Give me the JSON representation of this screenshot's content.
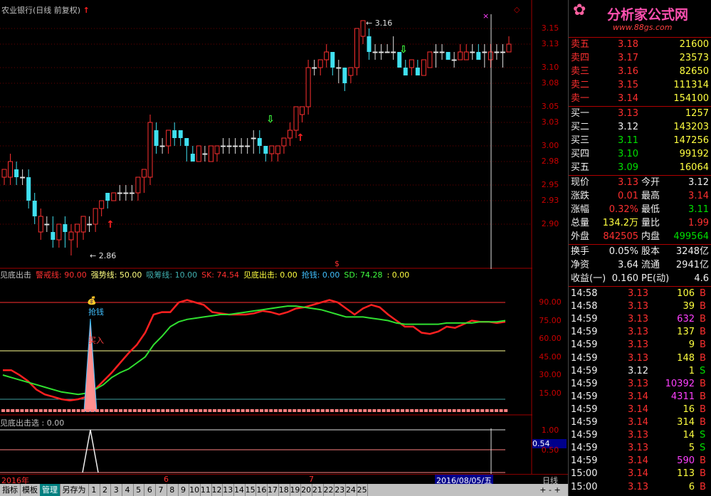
{
  "header": {
    "title": "农业银行(日线 前复权)",
    "up_marker": "↑",
    "x_marker": "×",
    "diamond_marker": "◇"
  },
  "main_axis": [
    "3.15",
    "3.13",
    "3.10",
    "3.08",
    "3.05",
    "3.03",
    "3.00",
    "2.98",
    "2.95",
    "2.93",
    "2.90"
  ],
  "annotations": {
    "high": "3.16",
    "low": "2.86",
    "dollar": "$"
  },
  "indicator": {
    "legend": [
      {
        "text": "见底出击",
        "color": "#c0c0c0"
      },
      {
        "text": "警戒线: 90.00",
        "color": "#ff3030"
      },
      {
        "text": "强势线: 50.00",
        "color": "#ffff80"
      },
      {
        "text": "吸筹线: 10.00",
        "color": "#40b0b0"
      },
      {
        "text": "SK: 74.54",
        "color": "#ff3030"
      },
      {
        "text": "见底出击: 0.00",
        "color": "#ffff40"
      },
      {
        "text": "抢钱: 0.00",
        "color": "#40c0ff"
      },
      {
        "text": "SD: 74.28",
        "color": "#40ff40"
      },
      {
        "text": ": 0.00",
        "color": "#ffff40"
      }
    ],
    "axis": [
      "90.00",
      "75.00",
      "60.00",
      "45.00",
      "30.00",
      "15.00"
    ],
    "label_qiangqian": "抢钱",
    "label_mairu": "买入"
  },
  "sub": {
    "legend": "见底出击选 : 0.00",
    "axis": [
      "1.00",
      "0.50"
    ],
    "cursor_value": "0.54"
  },
  "dates": {
    "year": "2016年",
    "m6": "6",
    "m7": "7",
    "cursor_date": "2016/08/05/五",
    "period": "日线"
  },
  "bottom_tabs": [
    "指标",
    "模板",
    "管理",
    "另存为",
    "1",
    "2",
    "3",
    "4",
    "5",
    "6",
    "7",
    "8",
    "9",
    "10",
    "11",
    "12",
    "13",
    "14",
    "15",
    "16",
    "17",
    "18",
    "19",
    "20",
    "21",
    "22",
    "23",
    "24",
    "25"
  ],
  "brand": {
    "name": "分析家公式网",
    "url": "www.88gs.com"
  },
  "orderbook": {
    "asks": [
      {
        "label": "卖五",
        "price": "3.18",
        "vol": "21600"
      },
      {
        "label": "卖四",
        "price": "3.17",
        "vol": "23573"
      },
      {
        "label": "卖三",
        "price": "3.16",
        "vol": "82650"
      },
      {
        "label": "卖二",
        "price": "3.15",
        "vol": "111314"
      },
      {
        "label": "卖一",
        "price": "3.14",
        "vol": "154100"
      }
    ],
    "bids": [
      {
        "label": "买一",
        "price": "3.13",
        "vol": "1257",
        "pc": "red"
      },
      {
        "label": "买二",
        "price": "3.12",
        "vol": "143203",
        "pc": "wht"
      },
      {
        "label": "买三",
        "price": "3.11",
        "vol": "147256",
        "pc": "grn"
      },
      {
        "label": "买四",
        "price": "3.10",
        "vol": "99192",
        "pc": "grn"
      },
      {
        "label": "买五",
        "price": "3.09",
        "vol": "16064",
        "pc": "grn"
      }
    ]
  },
  "quote": [
    {
      "l": "现价",
      "v": "3.13",
      "vc": "red",
      "l2": "今开",
      "v2": "3.12",
      "v2c": "wht"
    },
    {
      "l": "涨跌",
      "v": "0.01",
      "vc": "red",
      "l2": "最高",
      "v2": "3.14",
      "v2c": "red"
    },
    {
      "l": "涨幅",
      "v": "0.32%",
      "vc": "red",
      "l2": "最低",
      "v2": "3.11",
      "v2c": "grn"
    },
    {
      "l": "总量",
      "v": "134.2万",
      "vc": "yel",
      "l2": "量比",
      "v2": "1.99",
      "v2c": "red"
    },
    {
      "l": "外盘",
      "v": "842505",
      "vc": "red",
      "l2": "内盘",
      "v2": "499564",
      "v2c": "grn"
    }
  ],
  "stats": [
    {
      "l": "换手",
      "v": "0.05%",
      "l2": "股本",
      "v2": "3248亿"
    },
    {
      "l": "净资",
      "v": "3.64",
      "l2": "流通",
      "v2": "2941亿"
    },
    {
      "l": "收益(一)",
      "v": "0.160",
      "l2": "PE(动)",
      "v2": "4.6"
    }
  ],
  "ticks": [
    {
      "t": "14:58",
      "p": "3.13",
      "pc": "red",
      "v": "106",
      "vc": "yel",
      "s": "B",
      "sc": "red"
    },
    {
      "t": "14:58",
      "p": "3.13",
      "pc": "red",
      "v": "39",
      "vc": "yel",
      "s": "B",
      "sc": "red"
    },
    {
      "t": "14:59",
      "p": "3.13",
      "pc": "red",
      "v": "632",
      "vc": "mag",
      "s": "B",
      "sc": "red"
    },
    {
      "t": "14:59",
      "p": "3.13",
      "pc": "red",
      "v": "137",
      "vc": "yel",
      "s": "B",
      "sc": "red"
    },
    {
      "t": "14:59",
      "p": "3.13",
      "pc": "red",
      "v": "9",
      "vc": "yel",
      "s": "B",
      "sc": "red"
    },
    {
      "t": "14:59",
      "p": "3.13",
      "pc": "red",
      "v": "148",
      "vc": "yel",
      "s": "B",
      "sc": "red"
    },
    {
      "t": "14:59",
      "p": "3.12",
      "pc": "wht",
      "v": "1",
      "vc": "yel",
      "s": "S",
      "sc": "grn"
    },
    {
      "t": "14:59",
      "p": "3.13",
      "pc": "red",
      "v": "10392",
      "vc": "mag",
      "s": "B",
      "sc": "red"
    },
    {
      "t": "14:59",
      "p": "3.14",
      "pc": "red",
      "v": "4311",
      "vc": "mag",
      "s": "B",
      "sc": "red"
    },
    {
      "t": "14:59",
      "p": "3.14",
      "pc": "red",
      "v": "16",
      "vc": "yel",
      "s": "B",
      "sc": "red"
    },
    {
      "t": "14:59",
      "p": "3.14",
      "pc": "red",
      "v": "314",
      "vc": "yel",
      "s": "B",
      "sc": "red"
    },
    {
      "t": "14:59",
      "p": "3.13",
      "pc": "red",
      "v": "14",
      "vc": "yel",
      "s": "S",
      "sc": "grn"
    },
    {
      "t": "14:59",
      "p": "3.13",
      "pc": "red",
      "v": "5",
      "vc": "yel",
      "s": "S",
      "sc": "grn"
    },
    {
      "t": "14:59",
      "p": "3.14",
      "pc": "red",
      "v": "590",
      "vc": "mag",
      "s": "B",
      "sc": "red"
    },
    {
      "t": "15:00",
      "p": "3.14",
      "pc": "red",
      "v": "113",
      "vc": "yel",
      "s": "B",
      "sc": "red"
    },
    {
      "t": "15:00",
      "p": "3.13",
      "pc": "red",
      "v": "6",
      "vc": "yel",
      "s": "B",
      "sc": "red"
    }
  ],
  "chart_data": {
    "type": "candlestick",
    "candles": [
      {
        "o": 2.96,
        "c": 2.97,
        "h": 2.97,
        "l": 2.95
      },
      {
        "o": 2.96,
        "c": 2.98,
        "h": 2.99,
        "l": 2.95
      },
      {
        "o": 2.97,
        "c": 2.96,
        "h": 2.98,
        "l": 2.95
      },
      {
        "o": 2.96,
        "c": 2.96,
        "h": 2.97,
        "l": 2.95
      },
      {
        "o": 2.96,
        "c": 2.93,
        "h": 2.97,
        "l": 2.92
      },
      {
        "o": 2.93,
        "c": 2.91,
        "h": 2.94,
        "l": 2.9
      },
      {
        "o": 2.89,
        "c": 2.91,
        "h": 2.92,
        "l": 2.88
      },
      {
        "o": 2.9,
        "c": 2.9,
        "h": 2.91,
        "l": 2.89
      },
      {
        "o": 2.89,
        "c": 2.88,
        "h": 2.91,
        "l": 2.87
      },
      {
        "o": 2.88,
        "c": 2.9,
        "h": 2.9,
        "l": 2.87
      },
      {
        "o": 2.9,
        "c": 2.89,
        "h": 2.91,
        "l": 2.87
      },
      {
        "o": 2.88,
        "c": 2.89,
        "h": 2.9,
        "l": 2.86
      },
      {
        "o": 2.89,
        "c": 2.9,
        "h": 2.9,
        "l": 2.87
      },
      {
        "o": 2.89,
        "c": 2.91,
        "h": 2.91,
        "l": 2.88
      },
      {
        "o": 2.9,
        "c": 2.9,
        "h": 2.91,
        "l": 2.89
      },
      {
        "o": 2.9,
        "c": 2.92,
        "h": 2.92,
        "l": 2.89
      },
      {
        "o": 2.92,
        "c": 2.93,
        "h": 2.93,
        "l": 2.91
      },
      {
        "o": 2.94,
        "c": 2.93,
        "h": 2.94,
        "l": 2.92
      },
      {
        "o": 2.93,
        "c": 2.94,
        "h": 2.94,
        "l": 2.93
      },
      {
        "o": 2.94,
        "c": 2.94,
        "h": 2.95,
        "l": 2.93
      },
      {
        "o": 2.94,
        "c": 2.94,
        "h": 2.95,
        "l": 2.93
      },
      {
        "o": 2.94,
        "c": 2.94,
        "h": 2.95,
        "l": 2.93
      },
      {
        "o": 2.94,
        "c": 2.96,
        "h": 2.96,
        "l": 2.93
      },
      {
        "o": 2.96,
        "c": 2.97,
        "h": 2.97,
        "l": 2.94
      },
      {
        "o": 2.96,
        "c": 3.03,
        "h": 3.04,
        "l": 2.95
      },
      {
        "o": 3.02,
        "c": 3.0,
        "h": 3.03,
        "l": 2.99
      },
      {
        "o": 3.0,
        "c": 3.0,
        "h": 3.01,
        "l": 2.99
      },
      {
        "o": 3.0,
        "c": 3.02,
        "h": 3.02,
        "l": 2.99
      },
      {
        "o": 3.02,
        "c": 3.01,
        "h": 3.03,
        "l": 3.0
      },
      {
        "o": 3.02,
        "c": 3.01,
        "h": 3.02,
        "l": 3.0
      },
      {
        "o": 3.01,
        "c": 3.0,
        "h": 3.01,
        "l": 2.98
      },
      {
        "o": 2.99,
        "c": 2.98,
        "h": 3.0,
        "l": 2.98
      },
      {
        "o": 2.98,
        "c": 3.0,
        "h": 3.0,
        "l": 2.98
      },
      {
        "o": 2.99,
        "c": 2.99,
        "h": 3.0,
        "l": 2.98
      },
      {
        "o": 2.98,
        "c": 3.0,
        "h": 3.0,
        "l": 2.98
      },
      {
        "o": 2.99,
        "c": 3.0,
        "h": 3.0,
        "l": 2.98
      },
      {
        "o": 3.0,
        "c": 3.0,
        "h": 3.01,
        "l": 2.99
      },
      {
        "o": 3.0,
        "c": 3.0,
        "h": 3.01,
        "l": 2.99
      },
      {
        "o": 3.0,
        "c": 3.0,
        "h": 3.01,
        "l": 2.99
      },
      {
        "o": 3.0,
        "c": 3.0,
        "h": 3.01,
        "l": 2.99
      },
      {
        "o": 3.0,
        "c": 3.0,
        "h": 3.01,
        "l": 2.99
      },
      {
        "o": 3.01,
        "c": 3.01,
        "h": 3.02,
        "l": 2.99
      },
      {
        "o": 3.01,
        "c": 3.0,
        "h": 3.02,
        "l": 2.99
      },
      {
        "o": 3.0,
        "c": 2.99,
        "h": 3.0,
        "l": 2.98
      },
      {
        "o": 2.99,
        "c": 3.0,
        "h": 3.0,
        "l": 2.98
      },
      {
        "o": 2.99,
        "c": 3.0,
        "h": 3.0,
        "l": 2.98
      },
      {
        "o": 3.0,
        "c": 3.01,
        "h": 3.01,
        "l": 2.99
      },
      {
        "o": 3.01,
        "c": 3.02,
        "h": 3.03,
        "l": 3.0
      },
      {
        "o": 3.02,
        "c": 3.05,
        "h": 3.05,
        "l": 3.01
      },
      {
        "o": 3.04,
        "c": 3.05,
        "h": 3.05,
        "l": 3.03
      },
      {
        "o": 3.05,
        "c": 3.1,
        "h": 3.11,
        "l": 3.04
      },
      {
        "o": 3.1,
        "c": 3.1,
        "h": 3.11,
        "l": 3.09
      },
      {
        "o": 3.1,
        "c": 3.11,
        "h": 3.11,
        "l": 3.09
      },
      {
        "o": 3.11,
        "c": 3.12,
        "h": 3.13,
        "l": 3.1
      },
      {
        "o": 3.12,
        "c": 3.1,
        "h": 3.12,
        "l": 3.09
      },
      {
        "o": 3.1,
        "c": 3.1,
        "h": 3.11,
        "l": 3.08
      },
      {
        "o": 3.1,
        "c": 3.08,
        "h": 3.1,
        "l": 3.07
      },
      {
        "o": 3.09,
        "c": 3.1,
        "h": 3.1,
        "l": 3.08
      },
      {
        "o": 3.1,
        "c": 3.15,
        "h": 3.15,
        "l": 3.09
      },
      {
        "o": 3.14,
        "c": 3.16,
        "h": 3.16,
        "l": 3.13
      },
      {
        "o": 3.14,
        "c": 3.12,
        "h": 3.15,
        "l": 3.11
      },
      {
        "o": 3.12,
        "c": 3.12,
        "h": 3.13,
        "l": 3.11
      },
      {
        "o": 3.12,
        "c": 3.12,
        "h": 3.13,
        "l": 3.11
      },
      {
        "o": 3.12,
        "c": 3.12,
        "h": 3.13,
        "l": 3.12
      },
      {
        "o": 3.12,
        "c": 3.12,
        "h": 3.14,
        "l": 3.11
      },
      {
        "o": 3.12,
        "c": 3.1,
        "h": 3.12,
        "l": 3.1
      },
      {
        "o": 3.1,
        "c": 3.09,
        "h": 3.11,
        "l": 3.09
      },
      {
        "o": 3.1,
        "c": 3.11,
        "h": 3.11,
        "l": 3.09
      },
      {
        "o": 3.1,
        "c": 3.09,
        "h": 3.11,
        "l": 3.09
      },
      {
        "o": 3.09,
        "c": 3.11,
        "h": 3.11,
        "l": 3.09
      },
      {
        "o": 3.1,
        "c": 3.12,
        "h": 3.12,
        "l": 3.1
      },
      {
        "o": 3.12,
        "c": 3.12,
        "h": 3.13,
        "l": 3.1
      },
      {
        "o": 3.12,
        "c": 3.12,
        "h": 3.13,
        "l": 3.11
      },
      {
        "o": 3.12,
        "c": 3.11,
        "h": 3.12,
        "l": 3.11
      },
      {
        "o": 3.11,
        "c": 3.11,
        "h": 3.12,
        "l": 3.1
      },
      {
        "o": 3.11,
        "c": 3.12,
        "h": 3.13,
        "l": 3.11
      },
      {
        "o": 3.11,
        "c": 3.12,
        "h": 3.13,
        "l": 3.11
      },
      {
        "o": 3.12,
        "c": 3.12,
        "h": 3.13,
        "l": 3.11
      },
      {
        "o": 3.12,
        "c": 3.11,
        "h": 3.13,
        "l": 3.11
      },
      {
        "o": 3.12,
        "c": 3.12,
        "h": 3.13,
        "l": 3.1
      },
      {
        "o": 3.11,
        "c": 3.12,
        "h": 3.13,
        "l": 3.1
      },
      {
        "o": 3.12,
        "c": 3.12,
        "h": 3.13,
        "l": 3.11
      },
      {
        "o": 3.12,
        "c": 3.12,
        "h": 3.13,
        "l": 3.1
      },
      {
        "o": 3.12,
        "c": 3.13,
        "h": 3.14,
        "l": 3.12
      }
    ],
    "ylim": [
      2.85,
      3.17
    ],
    "sk": [
      34,
      34,
      30,
      25,
      18,
      14,
      12,
      10,
      9,
      10,
      12,
      18,
      25,
      32,
      40,
      48,
      55,
      65,
      80,
      82,
      82,
      90,
      92,
      90,
      88,
      82,
      81,
      80,
      80,
      80,
      81,
      83,
      82,
      80,
      82,
      85,
      86,
      88,
      90,
      92,
      90,
      85,
      80,
      85,
      88,
      86,
      80,
      75,
      70,
      70,
      65,
      64,
      66,
      70,
      69,
      72,
      75,
      74,
      74,
      73,
      74
    ],
    "sd": [
      30,
      28,
      26,
      24,
      22,
      20,
      18,
      16,
      15,
      14,
      15,
      18,
      22,
      28,
      32,
      35,
      40,
      45,
      55,
      62,
      70,
      74,
      76,
      77,
      78,
      79,
      80,
      80,
      81,
      82,
      83,
      84,
      85,
      86,
      87,
      87,
      86,
      85,
      84,
      82,
      80,
      78,
      78,
      78,
      77,
      76,
      75,
      73,
      72,
      72,
      72,
      72,
      72,
      73,
      73,
      73,
      73,
      74,
      74,
      74,
      75
    ],
    "ind_ylim": [
      0,
      100
    ],
    "ind_lines": {
      "alarm": 90,
      "strong": 50,
      "absorb": 10
    }
  }
}
